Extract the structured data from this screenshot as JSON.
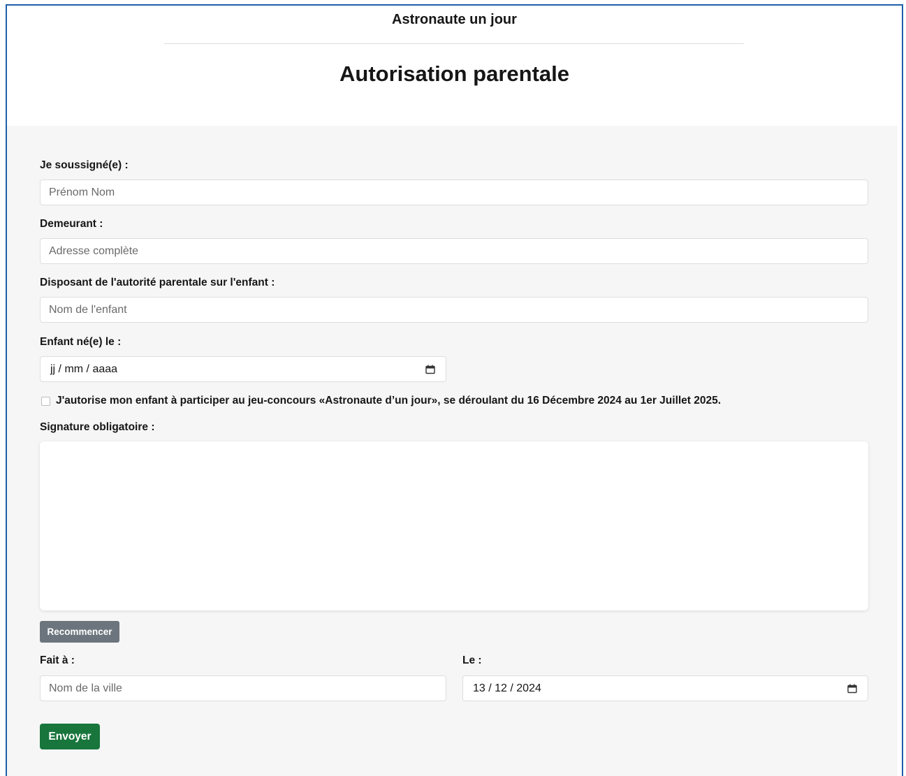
{
  "header": {
    "site_title": "Astronaute un jour",
    "page_title": "Autorisation parentale"
  },
  "form": {
    "signatory": {
      "label": "Je soussigné(e) :",
      "placeholder": "Prénom Nom",
      "value": ""
    },
    "address": {
      "label": "Demeurant :",
      "placeholder": "Adresse complète",
      "value": ""
    },
    "child_name": {
      "label": "Disposant de l'autorité parentale sur l'enfant :",
      "placeholder": "Nom de l'enfant",
      "value": ""
    },
    "birth_date": {
      "label": "Enfant né(e) le :",
      "value": "jj / mm / aaaa",
      "icon": "calendar-icon"
    },
    "consent": {
      "checked": false,
      "label": "J'autorise mon enfant à participer au jeu-concours «Astronaute d’un jour», se déroulant du 16 Décembre 2024 au 1er Juillet 2025."
    },
    "signature": {
      "label": "Signature obligatoire :"
    },
    "reset_label": "Recommencer",
    "place": {
      "label": "Fait à :",
      "placeholder": "Nom de la ville",
      "value": ""
    },
    "date": {
      "label": "Le :",
      "value": "13 / 12 / 2024",
      "icon": "calendar-icon"
    },
    "submit_label": "Envoyer"
  },
  "colors": {
    "submit": "#18753c",
    "reset": "#6c757d",
    "frame_border": "#1f5fa8",
    "form_background": "#f6f6f6"
  }
}
